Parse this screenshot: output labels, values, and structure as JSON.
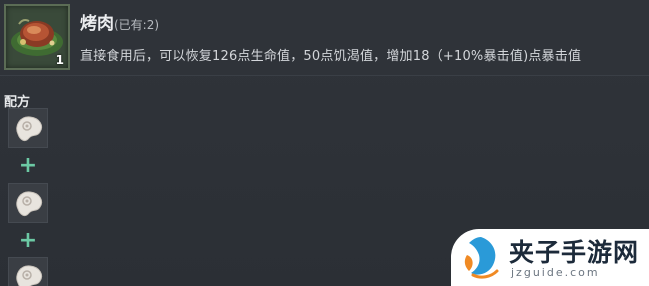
{
  "item": {
    "name": "烤肉",
    "owned": "(已有:2)",
    "count": "1",
    "icon": "roasted-meat-icon",
    "description": "直接食用后，可以恢复126点生命值，50点饥渴值，增加18（+10%暴击值)点暴击值"
  },
  "recipe": {
    "title": "配方",
    "separator": "+",
    "ingredients": [
      {
        "icon": "raw-meat-icon"
      },
      {
        "icon": "raw-meat-icon"
      },
      {
        "icon": "raw-meat-icon"
      }
    ]
  },
  "watermark": {
    "title": "夹子手游网",
    "url": "jzguide.com"
  },
  "colors": {
    "background": "#2c3036",
    "plus": "#6cc9a4",
    "slot_border": "#5b6c55"
  }
}
